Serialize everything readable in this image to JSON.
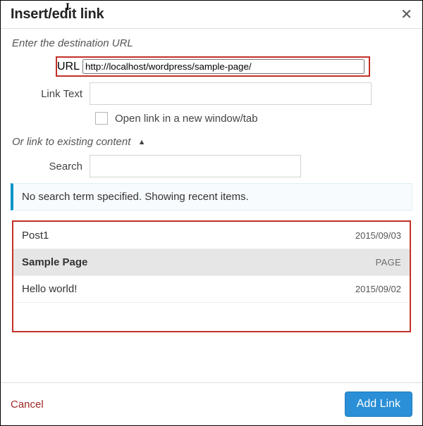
{
  "dialog": {
    "title": "Insert/edit link"
  },
  "section1": {
    "heading": "Enter the destination URL",
    "url_label": "URL",
    "url_value": "http://localhost/wordpress/sample-page/",
    "linktext_label": "Link Text",
    "linktext_value": "",
    "newtab_label": "Open link in a new window/tab"
  },
  "section2": {
    "heading": "Or link to existing content",
    "search_label": "Search",
    "search_value": ""
  },
  "results": {
    "info": "No search term specified. Showing recent items.",
    "items": [
      {
        "title": "Post1",
        "meta": "2015/09/03",
        "selected": false
      },
      {
        "title": "Sample Page",
        "meta": "PAGE",
        "selected": true
      },
      {
        "title": "Hello world!",
        "meta": "2015/09/02",
        "selected": false
      }
    ]
  },
  "footer": {
    "cancel": "Cancel",
    "add": "Add Link"
  }
}
